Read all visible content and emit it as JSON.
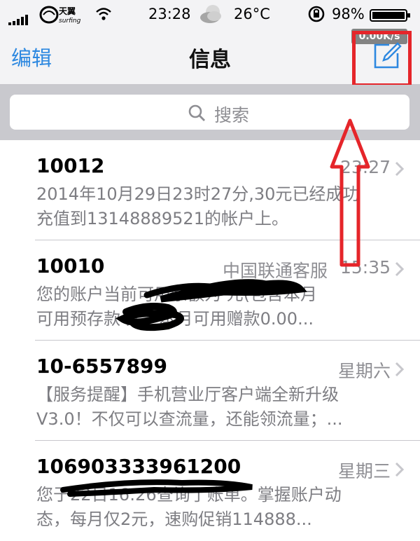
{
  "status_bar": {
    "carrier": "天翼 surfing",
    "time": "23:28",
    "temperature": "26°C",
    "battery": "98%"
  },
  "nav": {
    "edit_label": "编辑",
    "title": "信息",
    "network_speed": "0.00K/s"
  },
  "search": {
    "placeholder": "搜索"
  },
  "messages": [
    {
      "sender": "10012",
      "label": "",
      "time": "23:27",
      "preview_line1": "2014年10月29日23时27分,30元已经成功",
      "preview_line2": "充值到13148889521的帐户上。"
    },
    {
      "sender": "10010",
      "label": "中国联通客服",
      "time": "15:35",
      "preview_line1": "您的账户当前可用余额为  元(包含本月",
      "preview_line2": "可用预存款   元，本月可用赠款0.00..."
    },
    {
      "sender": "10-6557899",
      "label": "",
      "time": "星期六",
      "preview_line1": "【服务提醒】手机营业厅客户端全新升级",
      "preview_line2": "V3.0！不仅可以查流量，还能领流量；..."
    },
    {
      "sender": "106903333961200",
      "label": "",
      "time": "星期三",
      "preview_line1": "您于22日16:26查询了账单。掌握账户动",
      "preview_line2": "态，每月仅2元，速购促销114888..."
    }
  ],
  "colors": {
    "accent": "#2d88e0",
    "annotation": "#e5252a",
    "secondary_text": "#8e8e93"
  }
}
